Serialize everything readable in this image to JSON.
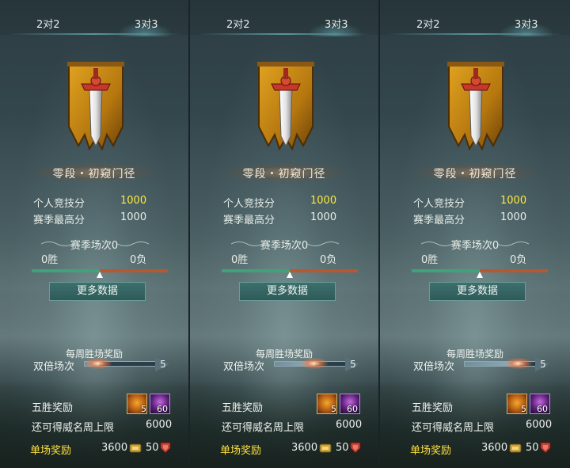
{
  "panels": [
    {
      "tabs": {
        "left": "2对2",
        "right": "3对3"
      },
      "rank_title": "零段・初窥门径",
      "stats": [
        {
          "label": "个人竞技分",
          "value": "1000",
          "highlight": true
        },
        {
          "label": "赛季最高分",
          "value": "1000",
          "highlight": false
        }
      ],
      "season": {
        "title": "赛季场次0",
        "wins": "0胜",
        "losses": "0负",
        "win_ratio": 0.5
      },
      "more_button": "更多数据",
      "weekly": {
        "title": "每周胜场奖励",
        "double_label": "双倍场次",
        "double_count": "5",
        "double_progress": 0.2
      },
      "five_win": {
        "label": "五胜奖励",
        "scroll_count": "5",
        "gem_count": "60"
      },
      "cap": {
        "label": "还可得威名周上限",
        "value": "6000"
      },
      "single": {
        "label": "单场奖励",
        "coin_value": "3600",
        "shield_value": "50"
      }
    },
    {
      "tabs": {
        "left": "2对2",
        "right": "3对3"
      },
      "rank_title": "零段・初窥门径",
      "stats": [
        {
          "label": "个人竞技分",
          "value": "1000",
          "highlight": true
        },
        {
          "label": "赛季最高分",
          "value": "1000",
          "highlight": false
        }
      ],
      "season": {
        "title": "赛季场次0",
        "wins": "0胜",
        "losses": "0负",
        "win_ratio": 0.5
      },
      "more_button": "更多数据",
      "weekly": {
        "title": "每周胜场奖励",
        "double_label": "双倍场次",
        "double_count": "5",
        "double_progress": 0.55
      },
      "five_win": {
        "label": "五胜奖励",
        "scroll_count": "5",
        "gem_count": "60"
      },
      "cap": {
        "label": "还可得威名周上限",
        "value": "6000"
      },
      "single": {
        "label": "单场奖励",
        "coin_value": "3600",
        "shield_value": "50"
      }
    },
    {
      "tabs": {
        "left": "2对2",
        "right": "3对3"
      },
      "rank_title": "零段・初窥门径",
      "stats": [
        {
          "label": "个人竞技分",
          "value": "1000",
          "highlight": true
        },
        {
          "label": "赛季最高分",
          "value": "1000",
          "highlight": false
        }
      ],
      "season": {
        "title": "赛季场次0",
        "wins": "0胜",
        "losses": "0负",
        "win_ratio": 0.5
      },
      "more_button": "更多数据",
      "weekly": {
        "title": "每周胜场奖励",
        "double_label": "双倍场次",
        "double_count": "5",
        "double_progress": 0.75
      },
      "five_win": {
        "label": "五胜奖励",
        "scroll_count": "5",
        "gem_count": "60"
      },
      "cap": {
        "label": "还可得威名周上限",
        "value": "6000"
      },
      "single": {
        "label": "单场奖励",
        "coin_value": "3600",
        "shield_value": "50"
      }
    }
  ],
  "icons": {
    "emblem": "sword-banner-icon",
    "scroll": "scroll-icon",
    "gem": "gem-icon",
    "coin": "coin-icon",
    "shield": "shield-icon"
  },
  "colors": {
    "highlight": "#ffea3a",
    "single_label": "#ffe03a",
    "win_bar": "#3fa37a",
    "loss_bar": "#b9572d",
    "button": "#2e5b5a"
  }
}
